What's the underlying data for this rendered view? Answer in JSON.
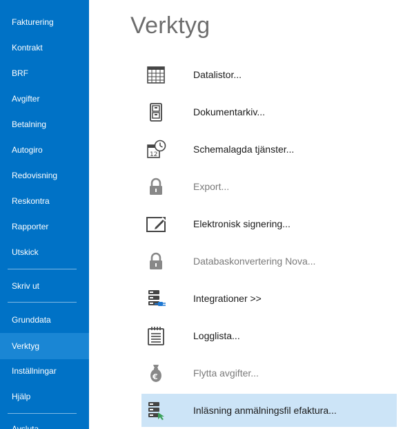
{
  "sidebar": {
    "items": [
      {
        "label": "Fakturering"
      },
      {
        "label": "Kontrakt"
      },
      {
        "label": "BRF"
      },
      {
        "label": "Avgifter"
      },
      {
        "label": "Betalning"
      },
      {
        "label": "Autogiro"
      },
      {
        "label": "Redovisning"
      },
      {
        "label": "Reskontra"
      },
      {
        "label": "Rapporter"
      },
      {
        "label": "Utskick"
      },
      {
        "label": "Skriv ut"
      },
      {
        "label": "Grunddata"
      },
      {
        "label": "Verktyg",
        "active": true
      },
      {
        "label": "Inställningar"
      },
      {
        "label": "Hjälp"
      },
      {
        "label": "Avsluta"
      }
    ]
  },
  "main": {
    "title": "Verktyg",
    "tools": [
      {
        "label": "Datalistor...",
        "icon": "calendar-grid-icon"
      },
      {
        "label": "Dokumentarkiv...",
        "icon": "file-cabinet-icon"
      },
      {
        "label": "Schemalagda tjänster...",
        "icon": "calendar-clock-icon"
      },
      {
        "label": "Export...",
        "icon": "lock-icon",
        "disabled": true
      },
      {
        "label": "Elektronisk signering...",
        "icon": "pen-signature-icon"
      },
      {
        "label": "Databaskonvertering Nova...",
        "icon": "lock-icon",
        "disabled": true
      },
      {
        "label": "Integrationer >>",
        "icon": "server-plug-icon"
      },
      {
        "label": "Logglista...",
        "icon": "notepad-icon"
      },
      {
        "label": "Flytta avgifter...",
        "icon": "money-bag-euro-icon",
        "disabled": true
      },
      {
        "label": "Inläsning anmälningsfil efaktura...",
        "icon": "server-arrow-icon",
        "selected": true
      }
    ]
  },
  "colors": {
    "sidebar_bg": "#0072c6",
    "sidebar_active": "#1a86d4",
    "selected_row": "#cce4f7",
    "plug_accent": "#1e78d2",
    "arrow_accent": "#3aa05a"
  }
}
